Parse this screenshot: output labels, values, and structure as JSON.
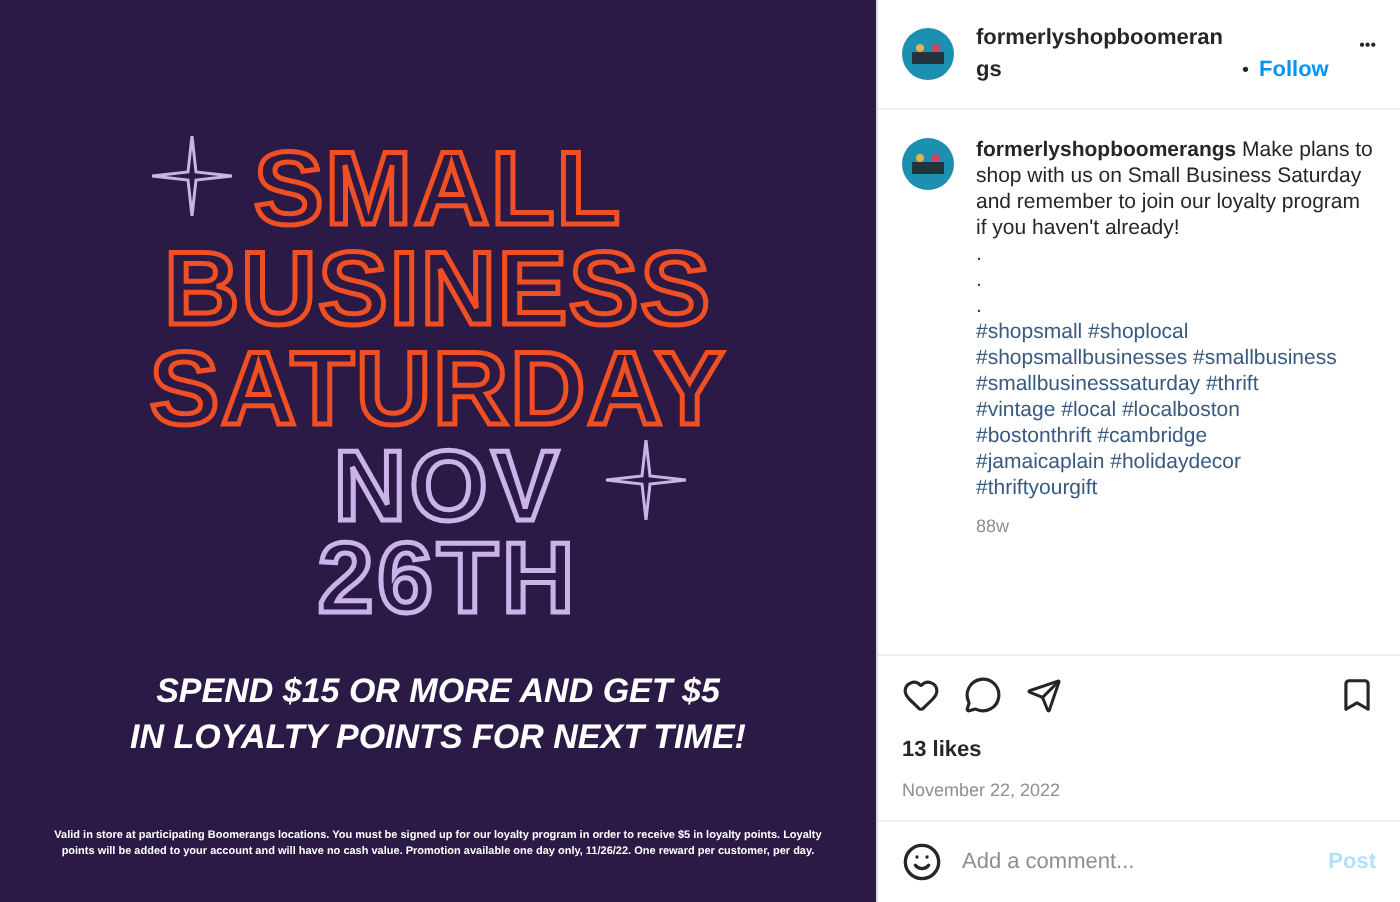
{
  "poster": {
    "title_lines": [
      "SMALL",
      "BUSINESS",
      "SATURDAY"
    ],
    "date_lines": [
      "NOV",
      "26TH"
    ],
    "offer_lines": [
      "SPEND $15 OR MORE AND GET $5",
      "IN LOYALTY POINTS FOR NEXT TIME!"
    ],
    "fine_print": "Valid in store at participating Boomerangs locations. You must be signed up for our loyalty program in order to receive $5 in loyalty points. Loyalty points will be added to your account and will have no cash value. Promotion available one day only, 11/26/22. One reward per customer, per day."
  },
  "header": {
    "username": "formerlyshopboomerangs",
    "separator": "•",
    "follow": "Follow",
    "more": "•••"
  },
  "caption": {
    "text": "**formerlyshopboomerangs** Make plans to shop with us on Small Business Saturday and remember to join our loyalty program if you haven't already!",
    "dots": [
      ".",
      ".",
      "."
    ],
    "hashtag_lines": [
      "#shopsmall #shoplocal",
      "#shopsmallbusinesses #smallbusiness",
      "#smallbusinesssaturday #thrift",
      "#vintage #local #localboston",
      "#bostonthrift #cambridge",
      "#jamaicaplain #holidaydecor",
      "#thriftyourgift"
    ],
    "age": "88w"
  },
  "actions": {
    "liked": false,
    "saved": false
  },
  "likes": "13 likes",
  "date": "November 22, 2022",
  "comment": {
    "placeholder": "Add a comment...",
    "post": "Post",
    "post_disabled": true
  }
}
